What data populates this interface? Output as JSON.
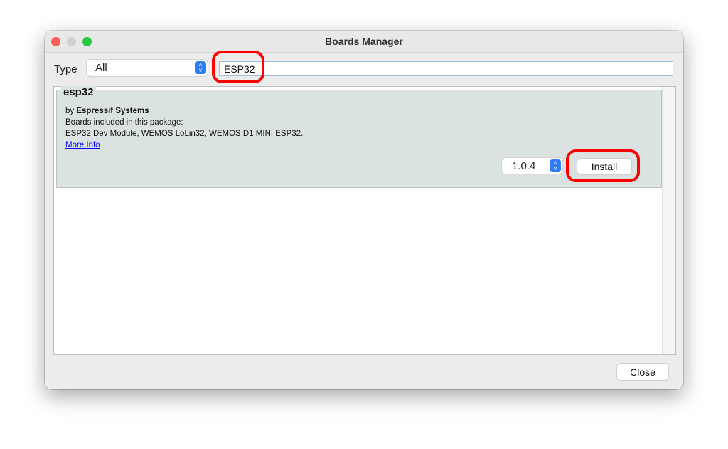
{
  "window": {
    "title": "Boards Manager"
  },
  "filter": {
    "type_label": "Type",
    "type_value": "All",
    "search_value": "ESP32"
  },
  "entries": [
    {
      "name": "esp32",
      "by_prefix": "by",
      "author": "Espressif Systems",
      "boards_label": "Boards included in this package:",
      "boards": "ESP32 Dev Module, WEMOS LoLin32, WEMOS D1 MINI ESP32.",
      "more_info": "More Info",
      "version": "1.0.4",
      "install_label": "Install"
    }
  ],
  "footer": {
    "close_label": "Close"
  },
  "colors": {
    "annotation": "#ff0000",
    "accent": "#2f7cf6",
    "link": "#0000ee"
  },
  "icons": {
    "stepper": "up-down-chevron-icon"
  }
}
